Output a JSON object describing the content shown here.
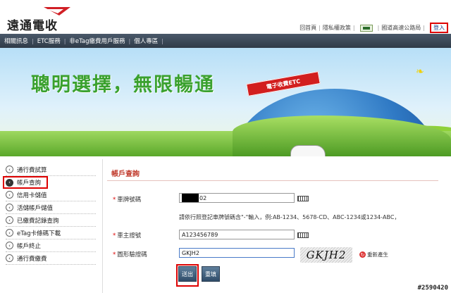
{
  "header": {
    "logo_text": "遠通電收",
    "links": [
      "回首頁",
      "隱私權政策"
    ],
    "gov_link": "國道高速公路局",
    "login": "登入"
  },
  "nav": {
    "items": [
      "相關訊息",
      "ETC服務",
      "非eTag繳費用戶服務",
      "個人專區"
    ]
  },
  "banner": {
    "title": "聰明選擇，無限暢通",
    "gantry_text": "電子收費ETC"
  },
  "sidebar": {
    "items": [
      {
        "label": "通行費試算",
        "active": false
      },
      {
        "label": "帳戶查詢",
        "active": true
      },
      {
        "label": "信用卡儲值",
        "active": false
      },
      {
        "label": "活儲帳戶儲值",
        "active": false
      },
      {
        "label": "已繳費記錄查詢",
        "active": false
      },
      {
        "label": "eTag卡條碼下載",
        "active": false
      },
      {
        "label": "帳戶終止",
        "active": false
      },
      {
        "label": "通行費繳費",
        "active": false
      }
    ]
  },
  "main": {
    "title": "帳戶查詢",
    "plate": {
      "required": "*",
      "label": "車牌號碼",
      "value_suffix": "02"
    },
    "hint": "請依行照登記車牌號碼含\"-\"輸入，例:AB-1234、5678-CD、ABC-1234或1234-ABC，",
    "owner": {
      "required": "*",
      "label": "車主證號",
      "value": "A123456789"
    },
    "captcha": {
      "required": "*",
      "label": "圖形驗證碼",
      "value": "GKJH2",
      "image_text": "GKJH2",
      "refresh": "重新產生"
    },
    "submit": "送出",
    "reset": "重填"
  },
  "watermark": "#2590420"
}
